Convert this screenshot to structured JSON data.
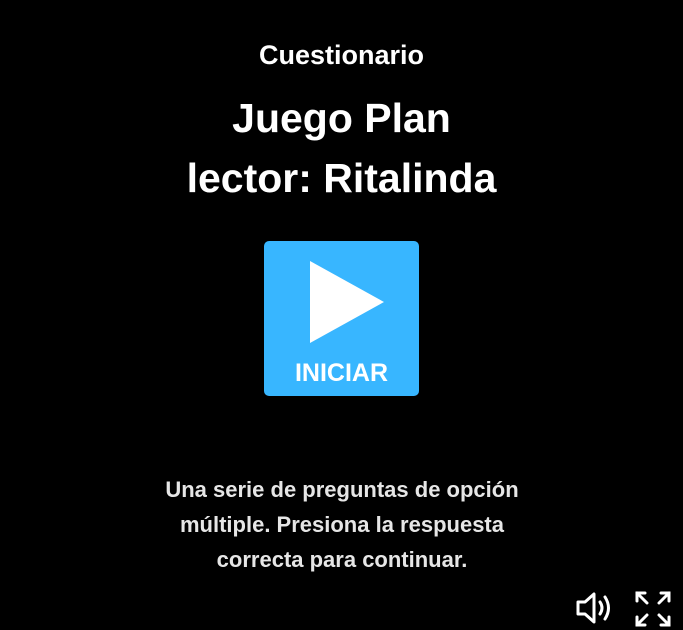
{
  "header": {
    "subtitle": "Cuestionario",
    "title_line_1": "Juego Plan",
    "title_line_2": "lector: Ritalinda"
  },
  "start_button": {
    "label": "INICIAR",
    "icon": "play-icon",
    "color": "#38b6ff"
  },
  "description": {
    "line_1": "Una serie de preguntas de opción",
    "line_2": "múltiple. Presiona la respuesta",
    "line_3": "correcta para continuar."
  },
  "controls": {
    "sound_icon": "speaker-icon",
    "fullscreen_icon": "fullscreen-icon"
  },
  "colors": {
    "background": "#000000",
    "text": "#ffffff",
    "accent": "#38b6ff"
  }
}
